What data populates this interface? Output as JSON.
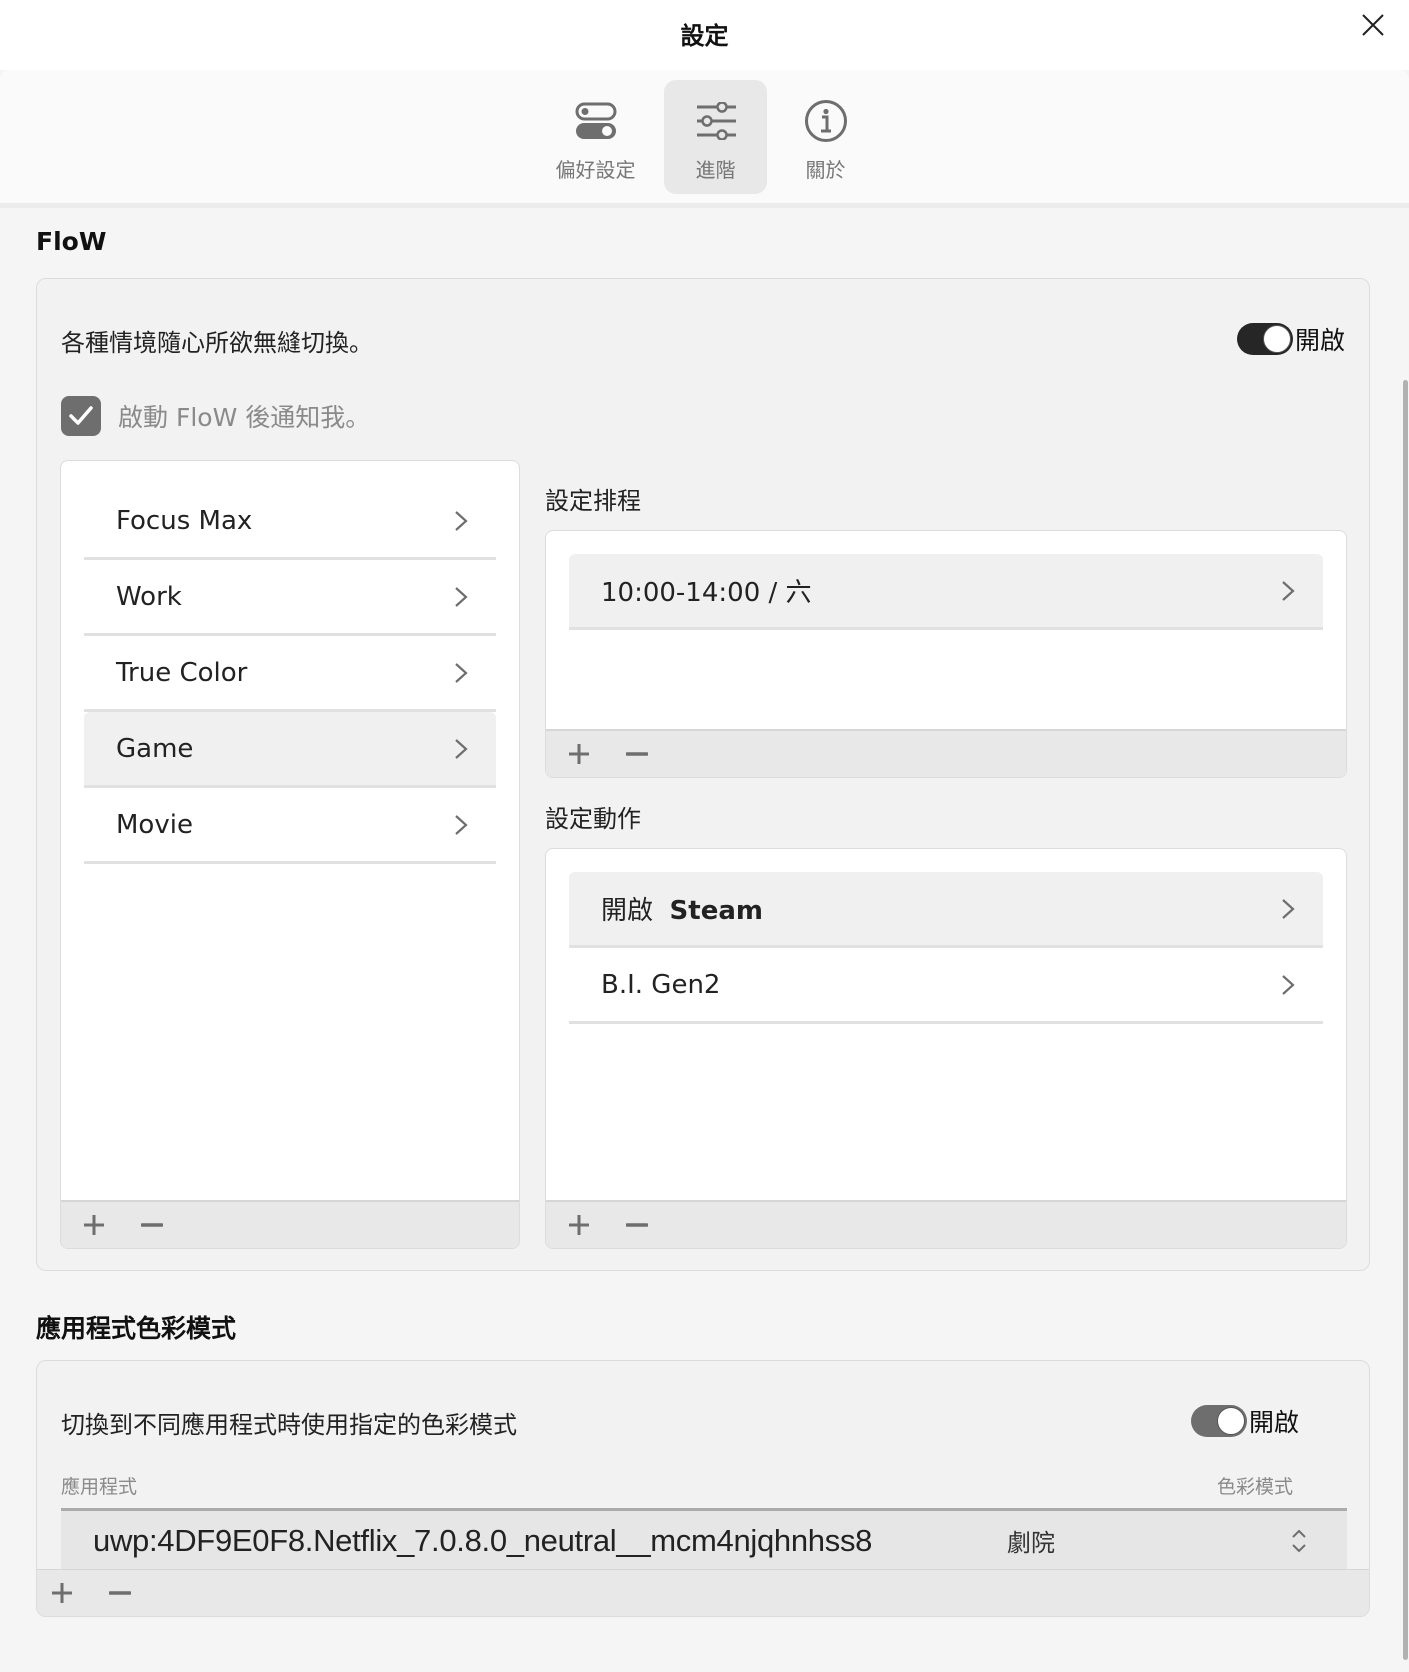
{
  "window": {
    "title": "設定",
    "close_icon": "close-icon"
  },
  "tabs": [
    {
      "label": "偏好設定",
      "icon": "toggles-icon",
      "selected": false
    },
    {
      "label": "進階",
      "icon": "sliders-icon",
      "selected": true
    },
    {
      "label": "關於",
      "icon": "info-icon",
      "selected": false
    }
  ],
  "flow": {
    "heading": "FloW",
    "description": "各種情境隨心所欲無縫切換。",
    "toggle": {
      "label": "開啟",
      "on": true,
      "color": "#262626"
    },
    "notify_checkbox": {
      "label": "啟動 FloW 後通知我。",
      "checked": true
    },
    "scenes": [
      {
        "label": "Focus Max",
        "selected": false
      },
      {
        "label": "Work",
        "selected": false
      },
      {
        "label": "True Color",
        "selected": false
      },
      {
        "label": "Game",
        "selected": true
      },
      {
        "label": "Movie",
        "selected": false
      }
    ],
    "schedule": {
      "heading": "設定排程",
      "items": [
        {
          "label": "10:00-14:00 / 六"
        }
      ]
    },
    "actions": {
      "heading": "設定動作",
      "items": [
        {
          "prefix": "開啟",
          "label": "Steam"
        },
        {
          "prefix": "",
          "label": "B.I. Gen2"
        }
      ]
    },
    "add_label": "+",
    "remove_label": "−"
  },
  "app_color_mode": {
    "heading": "應用程式色彩模式",
    "description": "切換到不同應用程式時使用指定的色彩模式",
    "toggle": {
      "label": "開啟",
      "on": true,
      "color": "#6e6e6e"
    },
    "columns": {
      "app": "應用程式",
      "mode": "色彩模式"
    },
    "rows": [
      {
        "app": "uwp:4DF9E0F8.Netflix_7.0.8.0_neutral__mcm4njqhnhss8",
        "mode": "劇院"
      }
    ]
  }
}
